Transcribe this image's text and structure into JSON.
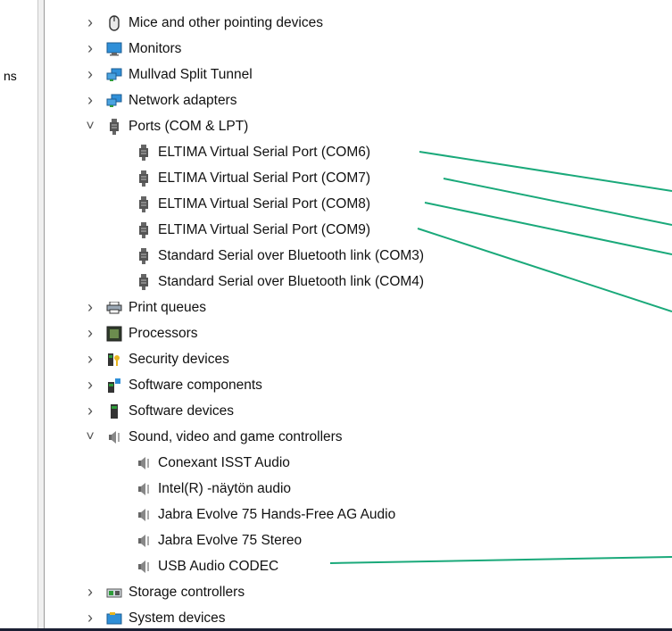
{
  "left_pane": {
    "truncated_label": "ns"
  },
  "tree": {
    "categories": [
      {
        "label": "Mice and other pointing devices",
        "icon": "mouse-icon",
        "expanded": false
      },
      {
        "label": "Monitors",
        "icon": "monitor-icon",
        "expanded": false
      },
      {
        "label": "Mullvad Split Tunnel",
        "icon": "network-icon",
        "expanded": false
      },
      {
        "label": "Network adapters",
        "icon": "network-icon",
        "expanded": false
      },
      {
        "label": "Ports (COM & LPT)",
        "icon": "port-icon",
        "expanded": true,
        "children": [
          "ELTIMA Virtual Serial Port (COM6)",
          "ELTIMA Virtual Serial Port (COM7)",
          "ELTIMA Virtual Serial Port (COM8)",
          "ELTIMA Virtual Serial Port (COM9)",
          "Standard Serial over Bluetooth link (COM3)",
          "Standard Serial over Bluetooth link (COM4)"
        ]
      },
      {
        "label": "Print queues",
        "icon": "printer-icon",
        "expanded": false
      },
      {
        "label": "Processors",
        "icon": "processor-icon",
        "expanded": false
      },
      {
        "label": "Security devices",
        "icon": "security-icon",
        "expanded": false
      },
      {
        "label": "Software components",
        "icon": "software-components-icon",
        "expanded": false
      },
      {
        "label": "Software devices",
        "icon": "software-device-icon",
        "expanded": false
      },
      {
        "label": "Sound, video and game controllers",
        "icon": "speaker-icon",
        "expanded": true,
        "children": [
          "Conexant ISST Audio",
          "Intel(R) -näytön audio",
          "Jabra Evolve 75 Hands-Free AG Audio",
          "Jabra Evolve 75 Stereo",
          "USB Audio CODEC"
        ]
      },
      {
        "label": "Storage controllers",
        "icon": "storage-icon",
        "expanded": false
      },
      {
        "label": "System devices",
        "icon": "system-devices-icon",
        "expanded": false
      }
    ]
  },
  "colors": {
    "callout_line": "#1aa97a",
    "background": "#1b1f33"
  }
}
